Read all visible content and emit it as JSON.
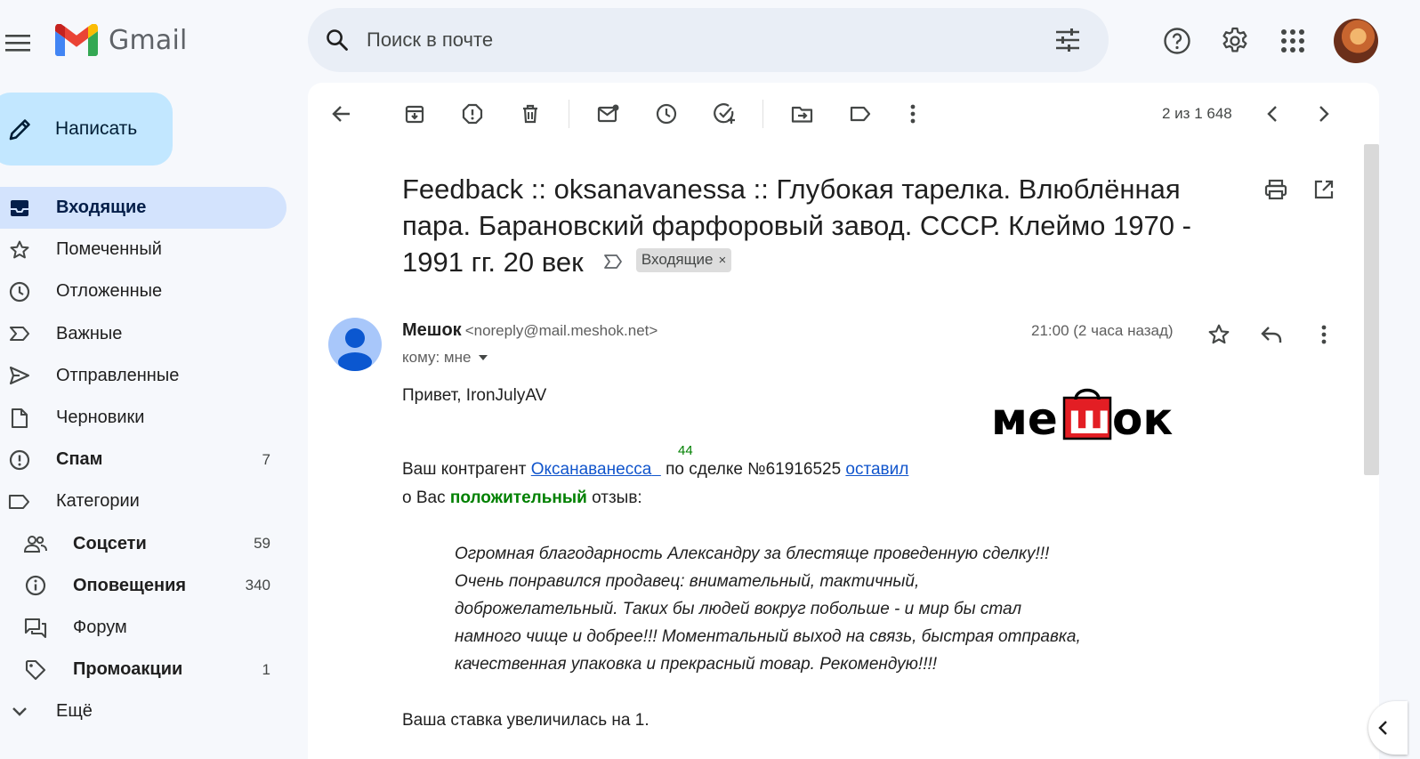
{
  "app": {
    "name": "Gmail",
    "brand_colors": {
      "red": "#ea4335",
      "blue": "#4285f4",
      "green": "#34a853",
      "yellow": "#fbbc04"
    }
  },
  "header": {
    "search_placeholder": "Поиск в почте",
    "icons": [
      "menu-icon",
      "search-icon",
      "search-options-icon",
      "help-icon",
      "settings-icon",
      "apps-icon"
    ]
  },
  "sidebar": {
    "compose_label": "Написать",
    "items": [
      {
        "label": "Входящие",
        "count": "",
        "icon": "inbox-icon",
        "active": true
      },
      {
        "label": "Помеченный",
        "count": "",
        "icon": "star-icon"
      },
      {
        "label": "Отложенные",
        "count": "",
        "icon": "clock-icon"
      },
      {
        "label": "Важные",
        "count": "",
        "icon": "important-icon"
      },
      {
        "label": "Отправленные",
        "count": "",
        "icon": "send-icon"
      },
      {
        "label": "Черновики",
        "count": "",
        "icon": "draft-icon"
      },
      {
        "label": "Спам",
        "count": "7",
        "icon": "spam-icon"
      },
      {
        "label": "Категории",
        "count": "",
        "icon": "label-icon"
      }
    ],
    "categories": [
      {
        "label": "Соцсети",
        "count": "59",
        "icon": "people-icon"
      },
      {
        "label": "Оповещения",
        "count": "340",
        "icon": "info-icon"
      },
      {
        "label": "Форум",
        "count": "",
        "icon": "forum-icon"
      },
      {
        "label": "Промоакции",
        "count": "1",
        "icon": "tag-icon"
      }
    ],
    "more_label": "Ещё"
  },
  "toolbar": {
    "pager": "2 из 1 648"
  },
  "message": {
    "subject": "Feedback :: oksanavanessa :: Глубокая тарелка. Влюблённая пара. Барановский фарфоровый завод. СССР. Клеймо 1970 - 1991 гг. 20 век",
    "label": "Входящие",
    "label_remove": "×",
    "sender_name": "Мешок",
    "sender_email": "<noreply@mail.meshok.net>",
    "to": "кому: мне",
    "time": "21:00 (2 часа назад)",
    "greeting": "Привет, IronJulyAV",
    "feedback_count": "44",
    "line1_prefix": "Ваш контрагент ",
    "counterparty": "Оксанаванесса",
    "line1_mid": " по сделке №61916525 ",
    "left_link": "оставил",
    "line2_prefix": "о Вас ",
    "positive": "положительный",
    "line2_suffix": " отзыв:",
    "quote_lines": [
      "Огромная благодарность Александру за блестяще проведенную сделку!!!",
      "Очень понравился продавец: внимательный, тактичный,",
      "доброжелательный. Таких бы людей вокруг побольше - и мир бы стал",
      "намного чище и добрее!!! Моментальный выход на связь, быстрая отправка,",
      "качественная упаковка и прекрасный товар. Рекомендую!!!!"
    ],
    "bid_line": "Ваша ставка увеличилась на 1.",
    "logo_text_left": "ме",
    "logo_text_mid": "ш",
    "logo_text_right": "ок"
  }
}
